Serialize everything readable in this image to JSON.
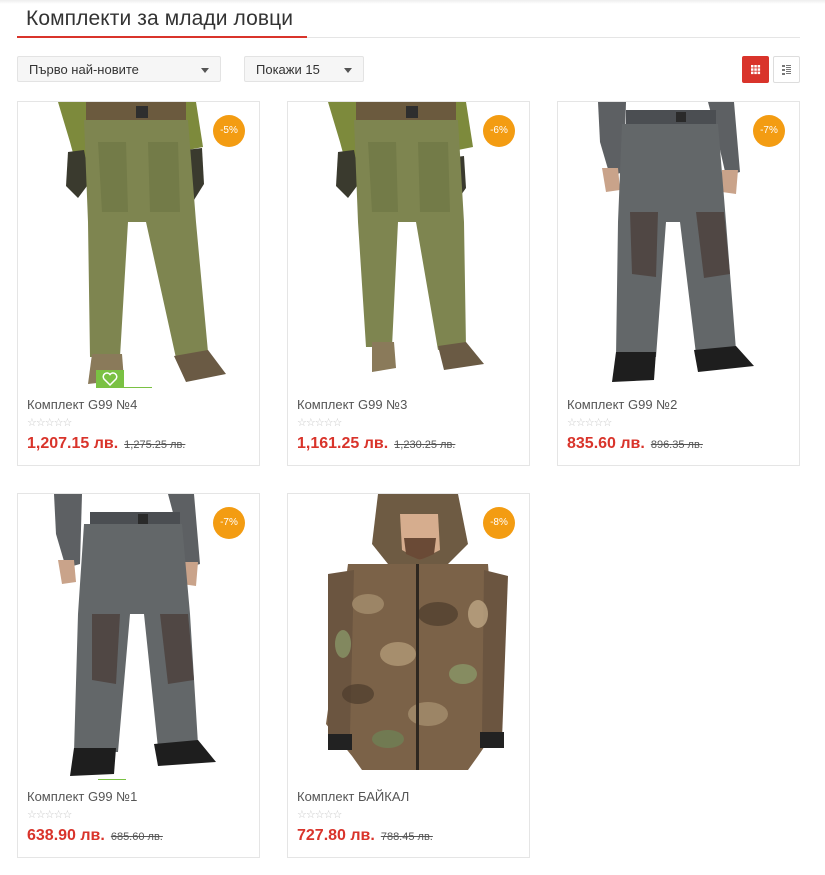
{
  "page": {
    "title": "Комплекти за млади ловци"
  },
  "toolbar": {
    "sort_label": "Първо най-новите",
    "limit_label": "Покажи 15",
    "grid_icon": "grid-icon",
    "list_icon": "list-icon",
    "accent_color": "#d9342b"
  },
  "products": [
    {
      "name": "Комплект G99 №4",
      "price": "1,207.15 лв.",
      "old_price": "1,275.25 лв.",
      "discount": "-5%",
      "rating": 0,
      "image": "olive-hunting-pants-photo"
    },
    {
      "name": "Комплект G99 №3",
      "price": "1,161.25 лв.",
      "old_price": "1,230.25 лв.",
      "discount": "-6%",
      "rating": 0,
      "image": "olive-hunting-pants-photo"
    },
    {
      "name": "Комплект G99 №2",
      "price": "835.60 лв.",
      "old_price": "896.35 лв.",
      "discount": "-7%",
      "rating": 0,
      "image": "grey-hunting-pants-photo"
    },
    {
      "name": "Комплект G99 №1",
      "price": "638.90 лв.",
      "old_price": "685.60 лв.",
      "discount": "-7%",
      "rating": 0,
      "image": "grey-hunting-pants-photo"
    },
    {
      "name": "Комплект БАЙКАЛ",
      "price": "727.80 лв.",
      "old_price": "788.45 лв.",
      "discount": "-8%",
      "rating": 0,
      "image": "camo-jacket-photo"
    }
  ],
  "icons": {
    "wishlist": "heart-icon",
    "stars": "star-icon"
  },
  "colors": {
    "badge": "#f39c12",
    "price": "#d9342b",
    "wishlist": "#7ac143"
  }
}
